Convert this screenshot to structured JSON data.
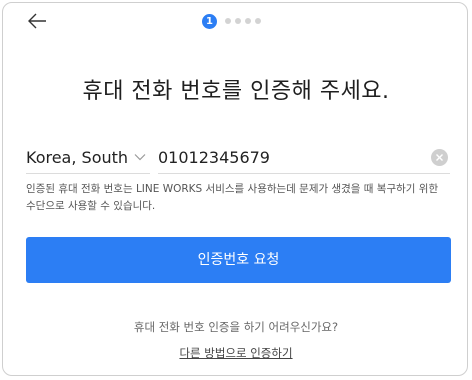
{
  "header": {
    "back_icon": "arrow-left-icon",
    "current_step": "1",
    "total_steps": 5
  },
  "title": "휴대 전화 번호를 인증해 주세요.",
  "form": {
    "country": "Korea, South",
    "country_chevron_icon": "chevron-down-icon",
    "phone": "01012345679",
    "clear_icon": "clear-icon"
  },
  "notice": "인증된 휴대 전화 번호는 LINE WORKS 서비스를 사용하는데 문제가 생겼을 때 복구하기 위한 수단으로 사용할 수 있습니다.",
  "request_button": "인증번호 요청",
  "help": {
    "question": "휴대 전화 번호 인증을 하기 어려우신가요?",
    "alt_link": "다른 방법으로 인증하기"
  },
  "colors": {
    "accent": "#2c7ef4",
    "step_inactive": "#d3d3d3",
    "clear_bg": "#cfcfcf"
  }
}
